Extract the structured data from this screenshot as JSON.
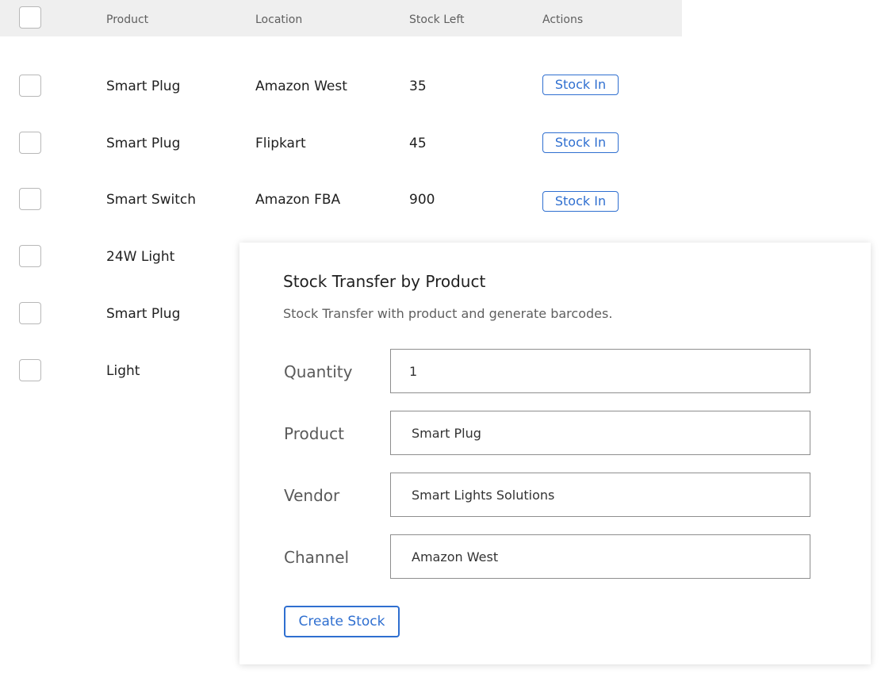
{
  "table": {
    "columns": {
      "product": "Product",
      "location": "Location",
      "stock_left": "Stock Left",
      "actions": "Actions"
    },
    "rows": [
      {
        "product": "Smart Plug",
        "location": "Amazon West",
        "stock_left": "35",
        "action": "Stock In"
      },
      {
        "product": "Smart Plug",
        "location": "Flipkart",
        "stock_left": "45",
        "action": "Stock In"
      },
      {
        "product": "Smart Switch",
        "location": "Amazon FBA",
        "stock_left": "900",
        "action": "Stock In"
      },
      {
        "product": "24W Light"
      },
      {
        "product": "Smart Plug"
      },
      {
        "product": "Light"
      }
    ]
  },
  "dialog": {
    "title": "Stock Transfer by Product",
    "subtitle": "Stock Transfer with product and generate barcodes.",
    "fields": {
      "quantity": {
        "label": "Quantity",
        "value": "1"
      },
      "product": {
        "label": "Product",
        "value": "Smart Plug"
      },
      "vendor": {
        "label": "Vendor",
        "value": "Smart Lights Solutions"
      },
      "channel": {
        "label": "Channel",
        "value": "Amazon West"
      }
    },
    "create_label": "Create Stock"
  },
  "colors": {
    "accent": "#2f6fd0",
    "header_bg": "#efefef"
  }
}
